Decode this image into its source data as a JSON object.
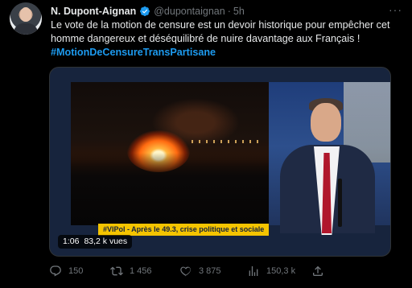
{
  "tweet": {
    "display_name": "N. Dupont-Aignan",
    "handle": "@dupontaignan",
    "separator": "·",
    "time": "5h",
    "text": "Le vote de la motion de censure est un devoir historique pour empêcher cet homme dangereux et déséquilibré de nuire davantage aux Français !",
    "hashtag": "#MotionDeCensureTransPartisane"
  },
  "media": {
    "banner": "#VIPol - Après le 49.3, crise politique et sociale",
    "duration": "1:06",
    "views": "83,2 k vues"
  },
  "actions": {
    "replies": "150",
    "retweets": "1 456",
    "likes": "3 875",
    "views": "150,3 k"
  },
  "colors": {
    "accent": "#1d9bf0",
    "muted": "#71767b",
    "banner": "#f5c400"
  },
  "icons": [
    "verified-badge-icon",
    "more-icon",
    "reply-icon",
    "retweet-icon",
    "like-icon",
    "views-icon",
    "share-icon"
  ]
}
